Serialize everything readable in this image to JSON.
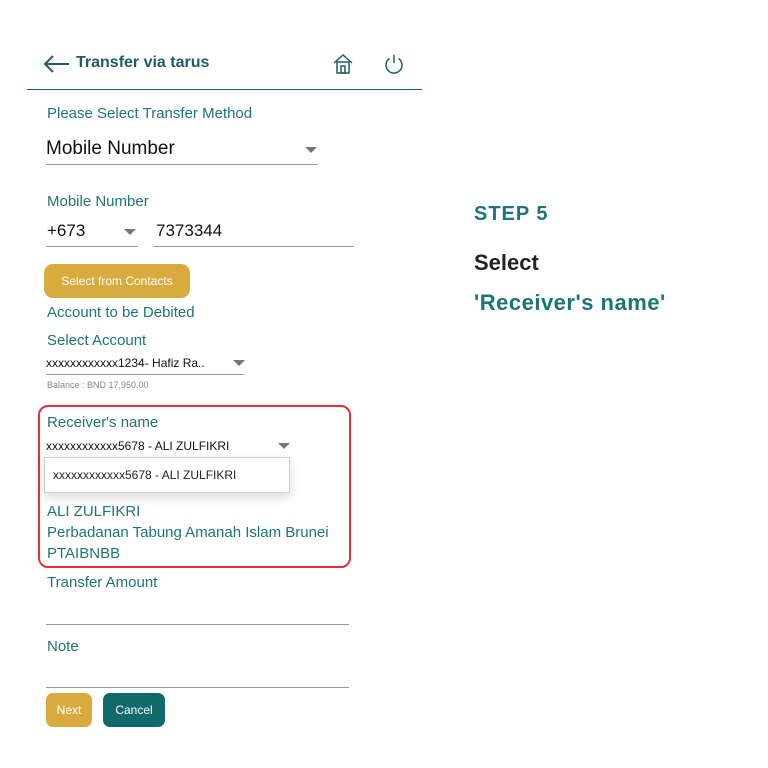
{
  "header": {
    "title": "Transfer via tarus"
  },
  "form": {
    "method_label": "Please Select Transfer Method",
    "method_value": "Mobile Number",
    "mobile_label": "Mobile Number",
    "country_code": "+673",
    "mobile_value": "7373344",
    "contacts_button": "Select from Contacts",
    "debit_label": "Account to be Debited",
    "select_account_label": "Select Account",
    "account_value": "xxxxxxxxxxxx1234- Hafiz Ra..",
    "balance_text": "Balance : BND 17,950.00",
    "receiver_label": "Receiver's name",
    "receiver_value": "xxxxxxxxxxxx5678 - ALI ZULFIKRI",
    "receiver_option": "xxxxxxxxxxxx5678 - ALI ZULFIKRI",
    "receiver_name": "ALI ZULFIKRI",
    "receiver_bank": "Perbadanan Tabung Amanah Islam Brunei",
    "receiver_code": "PTAIBNBB",
    "amount_label": "Transfer Amount",
    "note_label": "Note",
    "next_button": "Next",
    "cancel_button": "Cancel"
  },
  "instruction": {
    "step": "STEP 5",
    "action": "Select",
    "target": "'Receiver's name'"
  },
  "colors": {
    "teal": "#1e7479",
    "gold": "#d9ab3f",
    "highlight_red": "#e0323a"
  }
}
